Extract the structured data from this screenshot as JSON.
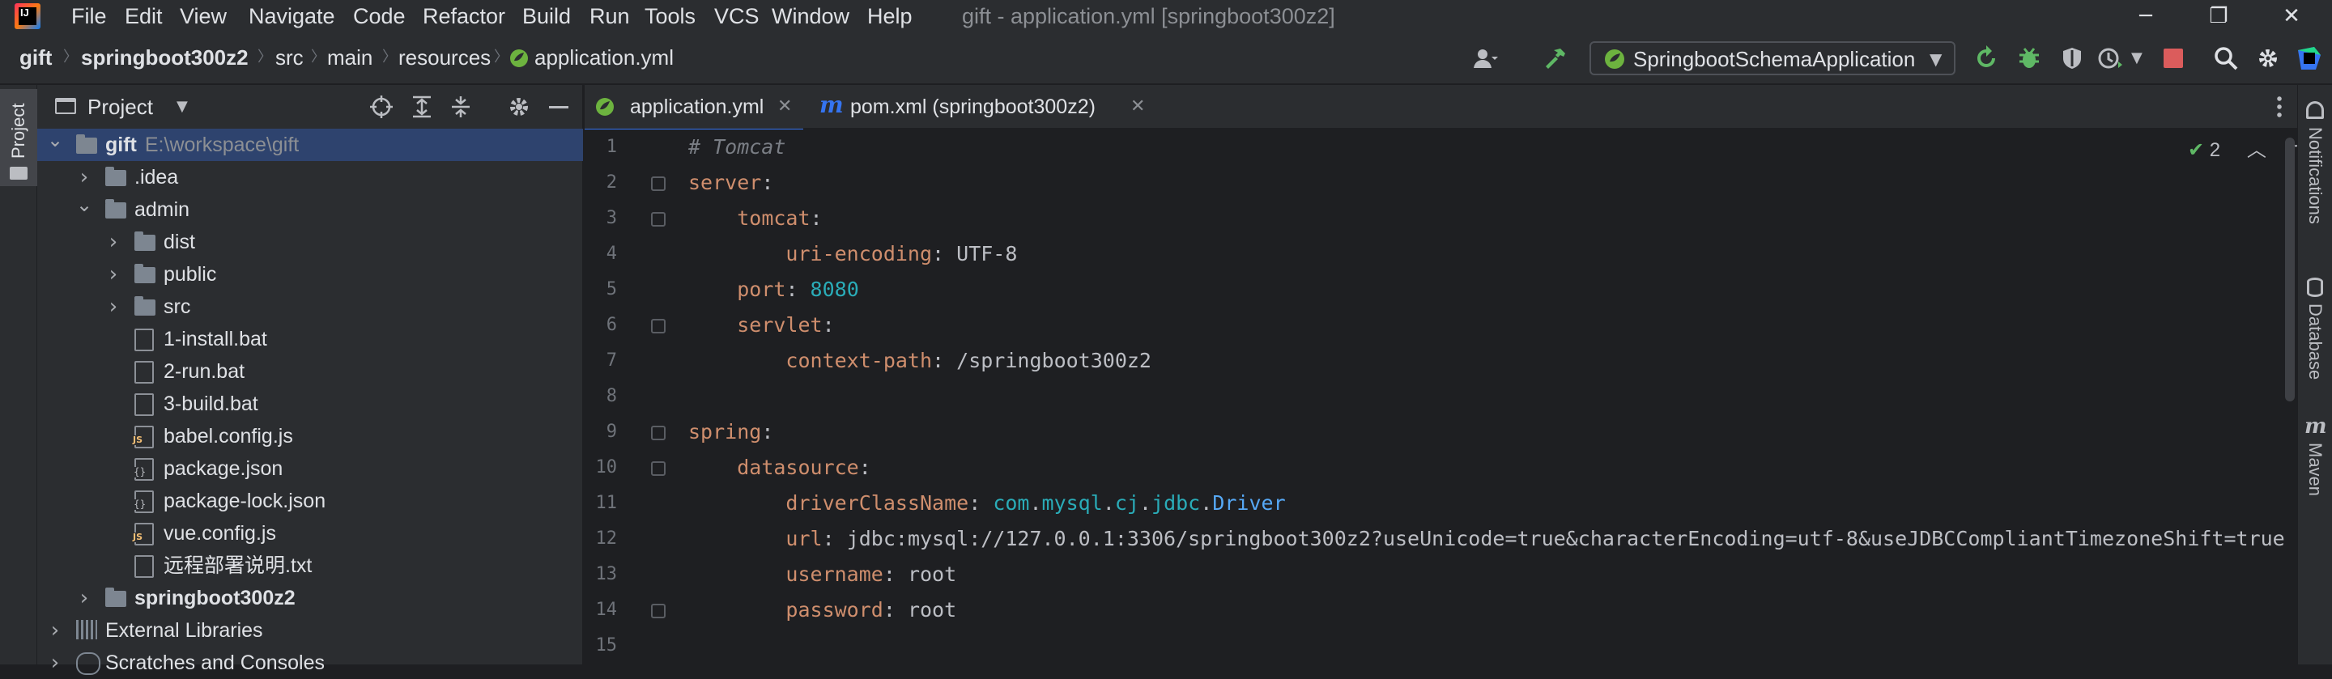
{
  "menu": [
    "File",
    "Edit",
    "View",
    "Navigate",
    "Code",
    "Refactor",
    "Build",
    "Run",
    "Tools",
    "VCS",
    "Window",
    "Help"
  ],
  "window_title": "gift - application.yml [springboot300z2]",
  "breadcrumb": [
    "gift",
    "springboot300z2",
    "src",
    "main",
    "resources",
    "application.yml"
  ],
  "run_config": "SpringbootSchemaApplication",
  "side_tabs": {
    "project": "Project",
    "notifications": "Notifications",
    "database": "Database",
    "maven": "Maven"
  },
  "project_panel": {
    "title": "Project",
    "tree": [
      {
        "label": "gift",
        "path": "E:\\workspace\\gift",
        "type": "module",
        "expand": "open"
      },
      {
        "label": ".idea",
        "type": "folder",
        "expand": "closed"
      },
      {
        "label": "admin",
        "type": "folder",
        "expand": "open"
      },
      {
        "label": "dist",
        "type": "folder",
        "expand": "closed"
      },
      {
        "label": "public",
        "type": "folder",
        "expand": "closed"
      },
      {
        "label": "src",
        "type": "folder",
        "expand": "closed"
      },
      {
        "label": "1-install.bat",
        "type": "file"
      },
      {
        "label": "2-run.bat",
        "type": "file"
      },
      {
        "label": "3-build.bat",
        "type": "file"
      },
      {
        "label": "babel.config.js",
        "type": "js"
      },
      {
        "label": "package.json",
        "type": "json"
      },
      {
        "label": "package-lock.json",
        "type": "json"
      },
      {
        "label": "vue.config.js",
        "type": "js"
      },
      {
        "label": "远程部署说明.txt",
        "type": "file"
      },
      {
        "label": "springboot300z2",
        "type": "module",
        "expand": "closed"
      },
      {
        "label": "External Libraries",
        "type": "lib",
        "expand": "closed"
      },
      {
        "label": "Scratches and Consoles",
        "type": "scratch",
        "expand": "closed"
      }
    ]
  },
  "editor_tabs": [
    {
      "label": "application.yml",
      "active": true
    },
    {
      "label": "pom.xml (springboot300z2)",
      "active": false
    }
  ],
  "inspection": {
    "count": "2"
  },
  "code_lines": [
    [
      [
        "c",
        "# Tomcat"
      ]
    ],
    [
      [
        "k",
        "server"
      ],
      [
        "p",
        ":"
      ]
    ],
    [
      [
        "p",
        "    "
      ],
      [
        "k",
        "tomcat"
      ],
      [
        "p",
        ":"
      ]
    ],
    [
      [
        "p",
        "        "
      ],
      [
        "k",
        "uri-encoding"
      ],
      [
        "p",
        ": "
      ],
      [
        "v",
        "UTF-8"
      ]
    ],
    [
      [
        "p",
        "    "
      ],
      [
        "k",
        "port"
      ],
      [
        "p",
        ": "
      ],
      [
        "n",
        "8080"
      ]
    ],
    [
      [
        "p",
        "    "
      ],
      [
        "k",
        "servlet"
      ],
      [
        "p",
        ":"
      ]
    ],
    [
      [
        "p",
        "        "
      ],
      [
        "k",
        "context-path"
      ],
      [
        "p",
        ": "
      ],
      [
        "v",
        "/springboot300z2"
      ]
    ],
    [],
    [
      [
        "k",
        "spring"
      ],
      [
        "p",
        ":"
      ]
    ],
    [
      [
        "p",
        "    "
      ],
      [
        "k",
        "datasource"
      ],
      [
        "p",
        ":"
      ]
    ],
    [
      [
        "p",
        "        "
      ],
      [
        "k",
        "driverClassName"
      ],
      [
        "p",
        ": "
      ],
      [
        "n",
        "com"
      ],
      [
        "p",
        "."
      ],
      [
        "n",
        "mysql"
      ],
      [
        "p",
        "."
      ],
      [
        "n",
        "cj"
      ],
      [
        "p",
        "."
      ],
      [
        "n",
        "jdbc"
      ],
      [
        "p",
        "."
      ],
      [
        "cls",
        "Driver"
      ]
    ],
    [
      [
        "p",
        "        "
      ],
      [
        "k",
        "url"
      ],
      [
        "p",
        ": "
      ],
      [
        "v",
        "jdbc:mysql://127.0.0.1:3306/springboot300z2?useUnicode=true&characterEncoding=utf-8&useJDBCCompliantTimezoneShift=true"
      ]
    ],
    [
      [
        "p",
        "        "
      ],
      [
        "k",
        "username"
      ],
      [
        "p",
        ": "
      ],
      [
        "v",
        "root"
      ]
    ],
    [
      [
        "p",
        "        "
      ],
      [
        "k",
        "password"
      ],
      [
        "p",
        ": "
      ],
      [
        "v",
        "root"
      ]
    ],
    []
  ],
  "colors": {
    "accent": "#3574f0",
    "keyword": "#cf8e6d",
    "number": "#2aacb8",
    "comment": "#7a7e85",
    "selection": "#2e436e"
  }
}
